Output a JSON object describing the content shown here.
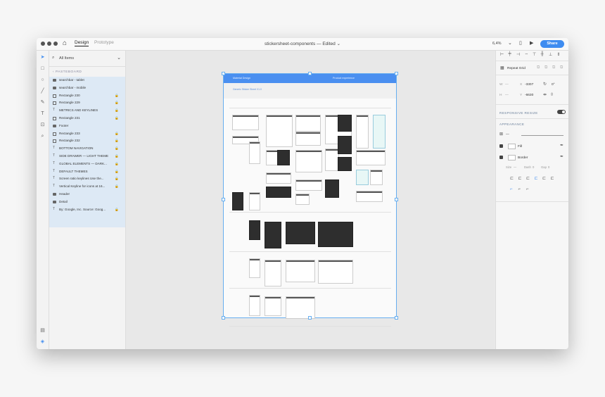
{
  "window": {
    "tabs": [
      "Design",
      "Prototype"
    ],
    "doc_title": "stickersheet-components — Edited ⌄",
    "zoom": "6,4%",
    "share": "Share"
  },
  "layers": {
    "search_placeholder": "All Items",
    "section": "PASTEBOARD",
    "items": [
      {
        "icon": "folder",
        "name": "searchbar - tablet",
        "locked": false
      },
      {
        "icon": "folder",
        "name": "searchbar - mobile",
        "locked": false
      },
      {
        "icon": "rect",
        "name": "Rectangle 230",
        "locked": true
      },
      {
        "icon": "rect",
        "name": "Rectangle 229",
        "locked": true
      },
      {
        "icon": "text",
        "name": "METRICS AND KEYLINES",
        "locked": true
      },
      {
        "icon": "rect",
        "name": "Rectangle 231",
        "locked": true
      },
      {
        "icon": "folder",
        "name": "Footer",
        "locked": false
      },
      {
        "icon": "rect",
        "name": "Rectangle 233",
        "locked": true
      },
      {
        "icon": "rect",
        "name": "Rectangle 232",
        "locked": true
      },
      {
        "icon": "text",
        "name": "BOTTOM NAVIGATION",
        "locked": true
      },
      {
        "icon": "text",
        "name": "SIDE DRAWER — LIGHT THEME",
        "locked": true
      },
      {
        "icon": "text",
        "name": "GLOBAL ELEMENTS — DARK...",
        "locked": true
      },
      {
        "icon": "text",
        "name": "DEFAULT THEMES",
        "locked": true
      },
      {
        "icon": "text",
        "name": "Screen ratio keylines  Use the...",
        "locked": true
      },
      {
        "icon": "text",
        "name": "Vertical Keyline for icons at 16...",
        "locked": true
      },
      {
        "icon": "folder",
        "name": "Header",
        "locked": false
      },
      {
        "icon": "folder",
        "name": "Detail",
        "locked": false
      },
      {
        "icon": "text",
        "name": "By: Google, Inc. Source: Goog...",
        "locked": true
      }
    ]
  },
  "artboard": {
    "header_left": "Material Design",
    "header_right": "Product experience",
    "sub_title": "Generic Sticker Sheet V1.0"
  },
  "props": {
    "repeat_grid": "Repeat Grid",
    "w_label": "W",
    "h_label": "H",
    "x_label": "X",
    "y_label": "Y",
    "x_value": "-3307",
    "y_value": "-6630",
    "rotation": "0°",
    "responsive_resize": "RESPONSIVE RESIZE",
    "appearance": "APPEARANCE",
    "fill": "Fill",
    "border": "Border",
    "size": "Size",
    "dash": "Dash",
    "gap": "Gap",
    "opacity": "—",
    "w_value": "—",
    "h_value": "—",
    "size_value": "—",
    "dash_value": "0",
    "gap_value": "0"
  },
  "colors": {
    "accent": "#3f8cf0",
    "header": "#4a8ff0",
    "selection": "#dde9f5"
  }
}
